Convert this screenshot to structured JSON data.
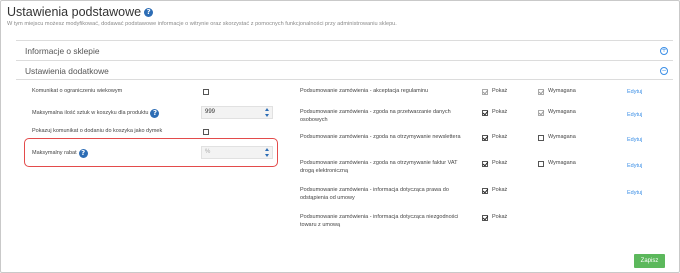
{
  "header": {
    "title": "Ustawienia podstawowe",
    "subtitle": "W tym miejscu możesz modyfikować, dodawać podstawowe informacje o witrynie oraz skorzystać z pomocnych funkcjonalności przy administrowaniu sklepu."
  },
  "panels": [
    {
      "title": "Informacje o sklepie",
      "icon": "expand-icon"
    },
    {
      "title": "Ustawienia dodatkowe",
      "icon": "collapse-icon"
    }
  ],
  "left_settings": {
    "age_limit_label": "Komunikat o ograniczeniu wiekowym",
    "age_limit_checked": false,
    "max_qty_label": "Maksymalna ilość sztuk w koszyku dla produktu",
    "max_qty_value": "999",
    "tooltip_label": "Pokazuj komunikat o dodaniu do koszyka jako dymek",
    "tooltip_checked": false,
    "max_discount_label": "Maksymalny rabat",
    "max_discount_placeholder": "%"
  },
  "summary_rows": [
    {
      "label": "Podsumowanie zamówienia - akceptacja regulaminu",
      "show_label": "Pokaż",
      "show": true,
      "show_disabled": true,
      "required_label": "Wymagana",
      "required": true,
      "required_disabled": true,
      "edit": "Edytuj"
    },
    {
      "label": "Podsumowanie zamówienia - zgoda na przetwarzanie danych osobowych",
      "show_label": "Pokaż",
      "show": true,
      "show_disabled": false,
      "required_label": "Wymagana",
      "required": true,
      "required_disabled": true,
      "edit": "Edytuj"
    },
    {
      "label": "Podsumowanie zamówienia - zgoda na otrzymywanie newslettera",
      "show_label": "Pokaż",
      "show": true,
      "show_disabled": false,
      "required_label": "Wymagana",
      "required": false,
      "required_disabled": false,
      "edit": "Edytuj"
    },
    {
      "label": "Podsumowanie zamówienia - zgoda na otrzymywanie faktur VAT drogą elektroniczną",
      "show_label": "Pokaż",
      "show": true,
      "show_disabled": false,
      "required_label": "Wymagana",
      "required": false,
      "required_disabled": false,
      "edit": "Edytuj"
    },
    {
      "label": "Podsumowanie zamówienia - informacja dotycząca prawa do odstąpienia od umowy",
      "show_label": "Pokaż",
      "show": true,
      "show_disabled": false,
      "required_label": "",
      "required": null,
      "required_disabled": false,
      "edit": "Edytuj"
    },
    {
      "label": "Podsumowanie zamówienia - informacja dotycząca niezgodności towaru z umową",
      "show_label": "Pokaż",
      "show": true,
      "show_disabled": false,
      "required_label": "",
      "required": null,
      "required_disabled": false,
      "edit": ""
    }
  ],
  "footer": {
    "save_label": "Zapisz"
  },
  "colors": {
    "accent": "#3a8ee6",
    "help_badge": "#2d6db5",
    "save_button": "#5cb85c",
    "highlight_box": "#e34b4b"
  }
}
